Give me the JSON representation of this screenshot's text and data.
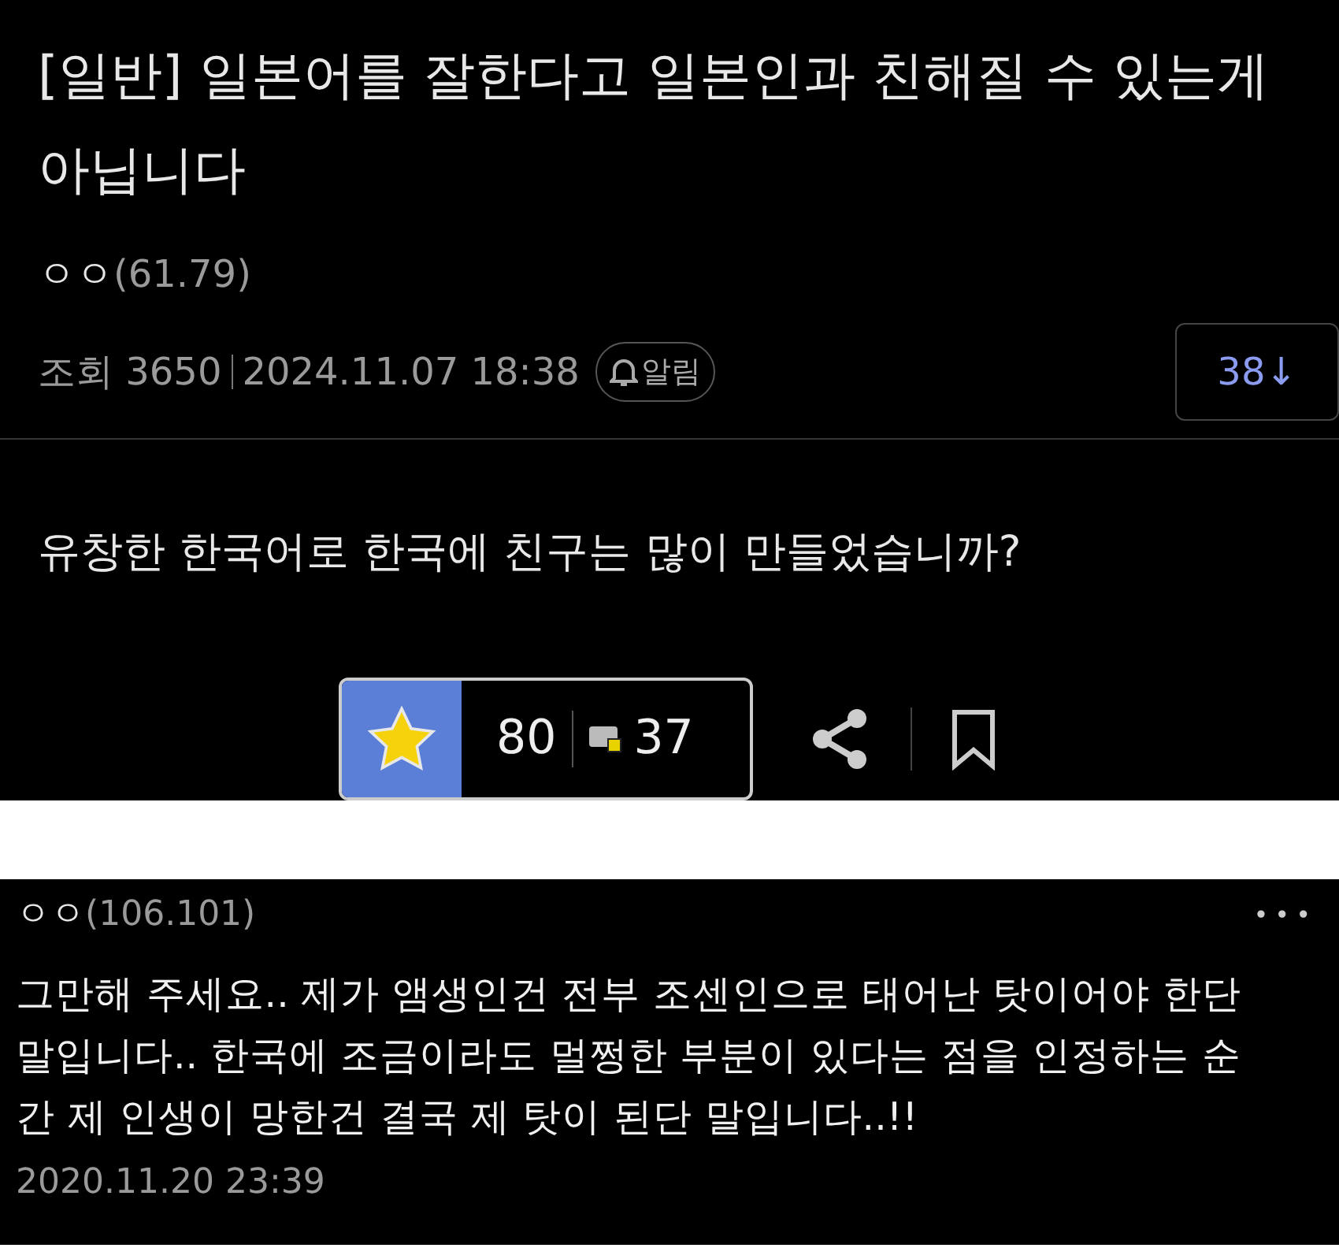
{
  "post": {
    "category": "[일반]",
    "title": "일본어를 잘한다고 일본인과 친해질 수 있는게 아닙니다",
    "author": {
      "name": "ㅇㅇ",
      "ip": "(61.79)"
    },
    "views_label": "조회 3650",
    "date": "2024.11.07 18:38",
    "alarm_label": "알림",
    "comment_count": "38↓",
    "body": "유창한 한국어로 한국에 친구는 많이 만들었습니까?",
    "recommend_count": "80",
    "fixed_recommend_count": "37"
  },
  "comment": {
    "author": {
      "name": "ㅇㅇ",
      "ip": "(106.101)"
    },
    "menu": "•••",
    "text": "그만해 주세요.. 제가 앰생인건 전부 조센인으로 태어난 탓이어야 한단 말입니다.. 한국에 조금이라도 멀쩡한 부분이 있다는 점을 인정하는 순간 제 인생이 망한건 결국 제 탓이 된단 말입니다..!!",
    "date": "2020.11.20 23:39"
  }
}
